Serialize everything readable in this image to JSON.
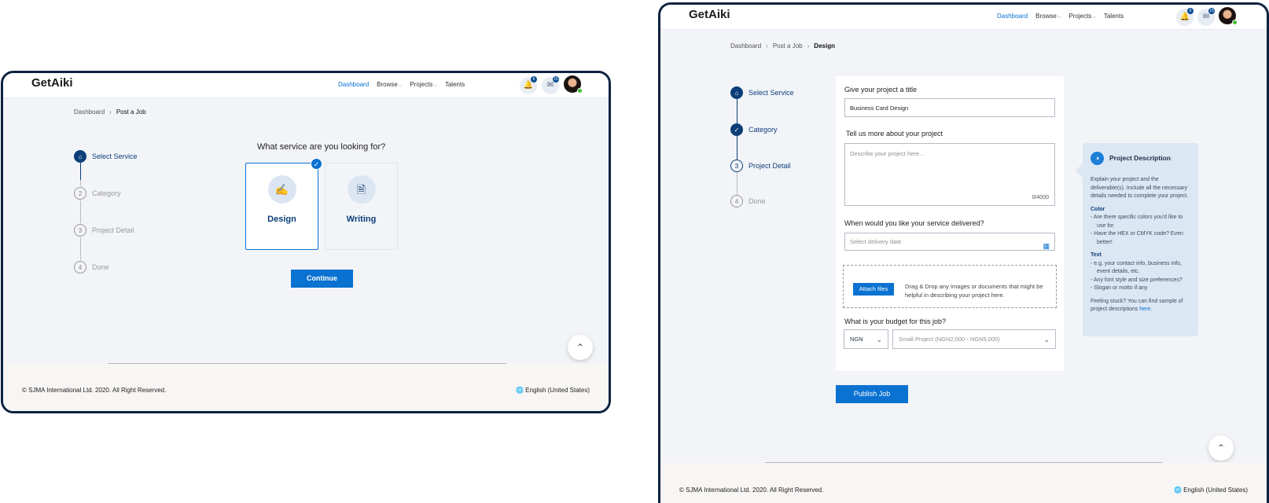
{
  "app": {
    "logo": "GetAiki"
  },
  "nav": {
    "items": [
      "Dashboard",
      "Browse",
      "Projects",
      "Talents"
    ],
    "chevron": "⌵"
  },
  "notifications": {
    "bell_count": "6",
    "mail_count": "15"
  },
  "steps": [
    "Select Service",
    "Category",
    "Project Detail",
    "Done"
  ],
  "step_numbers": [
    "2",
    "3",
    "4"
  ],
  "screen1": {
    "breadcrumb": [
      "Dashboard",
      "Post a Job"
    ],
    "heading": "What service are you looking for?",
    "cards": [
      "Design",
      "Writing"
    ],
    "continue_label": "Continue"
  },
  "screen2": {
    "breadcrumb": [
      "Dashboard",
      "Post a Job",
      "Design"
    ],
    "title_label": "Give your project a title",
    "title_value": "Business Card Design",
    "about_label": "Tell us more about your project",
    "about_placeholder": "Describe your project here...",
    "counter": "0/4000",
    "delivery_label": "When would you like your service delivered?",
    "delivery_placeholder": "Select delivery date",
    "attach_label": "Attach files",
    "drop_text": "Drag & Drop any Images or documents that might be helpful in describing your project here.",
    "budget_label": "What is your budget for this job?",
    "currency": "NGN",
    "budget_value": "Small Project (NGN2,000 - NGN5,000)",
    "publish_label": "Publish Job",
    "tip": {
      "title": "Project Description",
      "intro": "Explain your project and the deliverable(s). Include all the necessary details needed to complete your project.",
      "color_title": "Color",
      "color_items": [
        "- Are there specific colors you'd like to use for",
        "- Have the HEX or CMYK code? Even better!"
      ],
      "text_title": "Text",
      "text_items": [
        "- e.g. your contact info, business info, event details, etc.",
        "- Any font style and size preferences?",
        "- Slogan or motto if any"
      ],
      "stuck_text": "Feeling stuck? You can find sample of project descriptions",
      "stuck_link": "here."
    }
  },
  "footer": {
    "copyright": "© SJMA International Ltd. 2020. All Right Reserved.",
    "language": "English (United States)"
  },
  "colors": {
    "primary": "#0a72d1",
    "navy": "#0c3f78",
    "frame": "#0d2240",
    "background": "#f2f4f8"
  },
  "icons": [
    "home-icon",
    "check-icon",
    "bell-icon",
    "mail-icon",
    "design-pen-icon",
    "writing-icon",
    "calendar-icon",
    "lightbulb-icon",
    "globe-icon",
    "chevron-up-icon"
  ]
}
